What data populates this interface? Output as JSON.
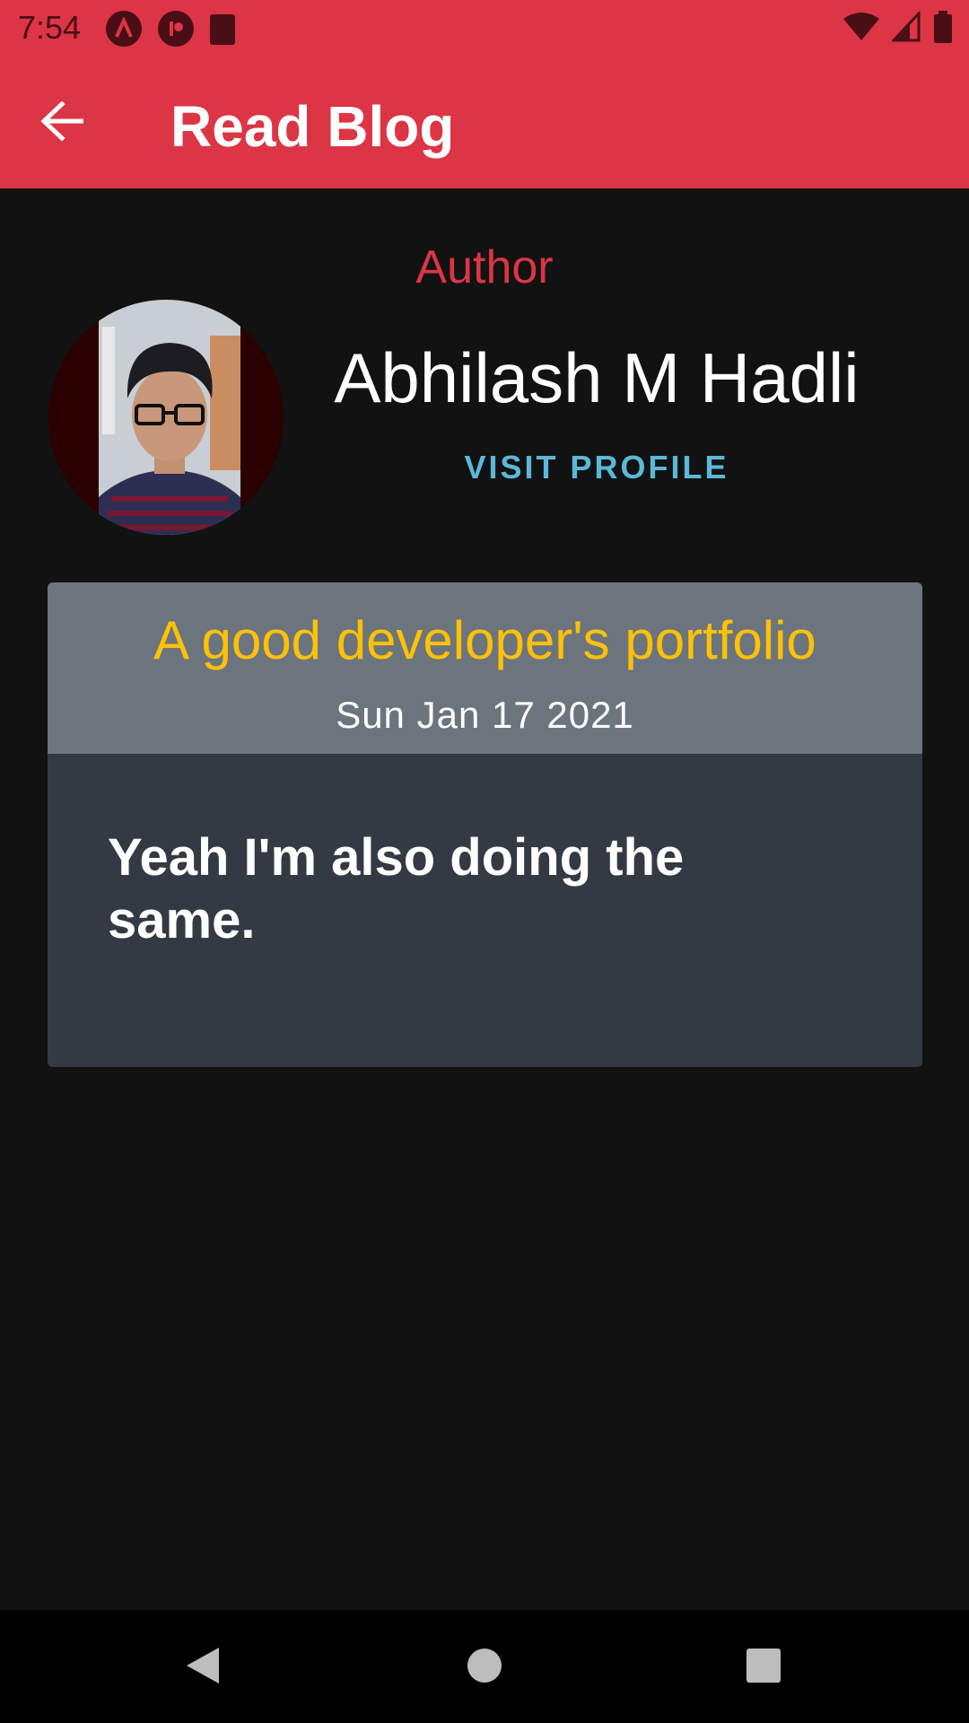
{
  "status_bar": {
    "time": "7:54",
    "left_icons": [
      "app-a-icon",
      "app-p-icon",
      "sd-card-icon"
    ],
    "right_icons": [
      "wifi-icon",
      "cell-signal-icon",
      "battery-icon"
    ]
  },
  "app_bar": {
    "title": "Read Blog",
    "back_icon": "arrow-back-icon"
  },
  "author": {
    "label": "Author",
    "name": "Abhilash M Hadli",
    "visit_profile": "VISIT PROFILE"
  },
  "blog": {
    "title": "A good developer's portfolio",
    "date": "Sun Jan 17 2021",
    "body": "Yeah I'm also doing the same."
  },
  "nav_bar": {
    "buttons": [
      "back-triangle-icon",
      "home-circle-icon",
      "recents-square-icon"
    ]
  },
  "colors": {
    "primary": "#dc3545",
    "title_yellow": "#ffc107",
    "link_blue": "#5bb8d8",
    "background": "#121212"
  }
}
